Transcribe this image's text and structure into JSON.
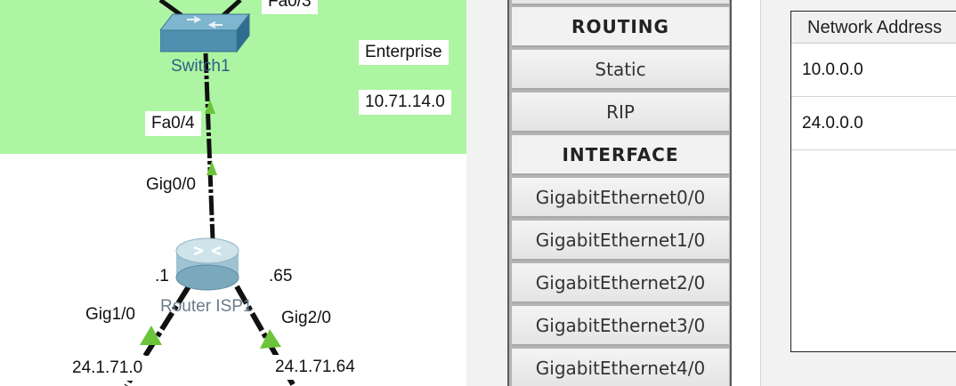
{
  "topology": {
    "cut_label": "Fa0/3",
    "switch_name": "Switch1",
    "enterprise_label": "Enterprise",
    "enterprise_network": "10.71.14.0",
    "fa_port": "Fa0/4",
    "gig00": "Gig0/0",
    "dot1": ".1",
    "dot65": ".65",
    "router_name": "Router ISP1",
    "gig10": "Gig1/0",
    "gig20": "Gig2/0",
    "net_left": "24.1.71.0",
    "net_right": "24.1.71.64",
    "colors": {
      "zone": "#adf5a2",
      "link": "#111111",
      "link_up": "#6cc43a"
    }
  },
  "menu": {
    "routing_header": "ROUTING",
    "static": "Static",
    "rip": "RIP",
    "interface_header": "INTERFACE",
    "interfaces": [
      "GigabitEthernet0/0",
      "GigabitEthernet1/0",
      "GigabitEthernet2/0",
      "GigabitEthernet3/0",
      "GigabitEthernet4/0"
    ]
  },
  "network_table": {
    "header": "Network Address",
    "rows": [
      "10.0.0.0",
      "24.0.0.0"
    ]
  }
}
